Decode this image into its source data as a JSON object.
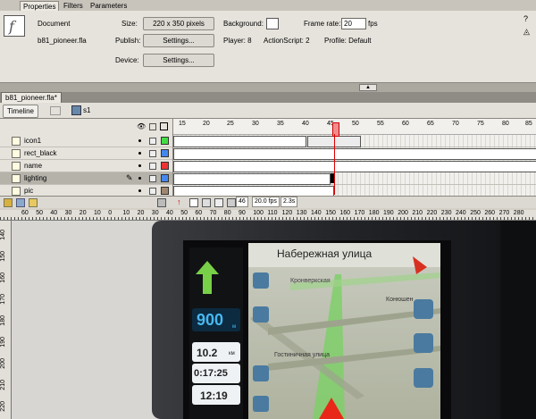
{
  "props_tabs": [
    "Properties",
    "Filters",
    "Parameters"
  ],
  "document": {
    "type_label": "Document",
    "filename": "b81_pioneer.fla",
    "size_label": "Size:",
    "size_value": "220 x 350 pixels",
    "background_label": "Background:",
    "framerate_label": "Frame rate:",
    "framerate_value": "20",
    "fps_unit": "fps",
    "publish_label": "Publish:",
    "settings_label": "Settings...",
    "player": "Player: 8",
    "actionscript": "ActionScript: 2",
    "profile": "Profile: Default",
    "device_label": "Device:",
    "device_settings": "Settings..."
  },
  "doc_tab": "b81_pioneer.fla*",
  "timeline_btn": "Timeline",
  "scene": "s1",
  "layers": [
    {
      "name": "icon1",
      "color": "#44dd44"
    },
    {
      "name": "rect_black",
      "color": "#4488ee"
    },
    {
      "name": "name",
      "color": "#ee3333"
    },
    {
      "name": "lighting",
      "color": "#4488ee"
    },
    {
      "name": "pic",
      "color": "#a08870"
    }
  ],
  "frame_numbers": [
    "15",
    "20",
    "25",
    "30",
    "35",
    "40",
    "45",
    "50",
    "55",
    "60",
    "65",
    "70",
    "75",
    "80",
    "85"
  ],
  "status": {
    "frame": "46",
    "fps": "20.0 fps",
    "time": "2.3s"
  },
  "hruler": [
    "60",
    "50",
    "40",
    "30",
    "20",
    "10",
    "0",
    "10",
    "20",
    "30",
    "40",
    "50",
    "60",
    "70",
    "80",
    "90",
    "100",
    "110",
    "120",
    "130",
    "140",
    "150",
    "160",
    "170",
    "180",
    "190",
    "200",
    "210",
    "220",
    "230",
    "240",
    "250",
    "260",
    "270",
    "280"
  ],
  "vruler": [
    "140",
    "150",
    "160",
    "170",
    "180",
    "190",
    "200",
    "210",
    "220"
  ],
  "map": {
    "street": "Набережная улица",
    "road1": "Кронверкская",
    "road2": "Конюшен",
    "road3": "Гостиничная улица",
    "speed": "900",
    "speed_unit": "м",
    "dist": "10.2",
    "dist_unit": "км",
    "eta": "0:17:25",
    "clock": "12:19"
  }
}
